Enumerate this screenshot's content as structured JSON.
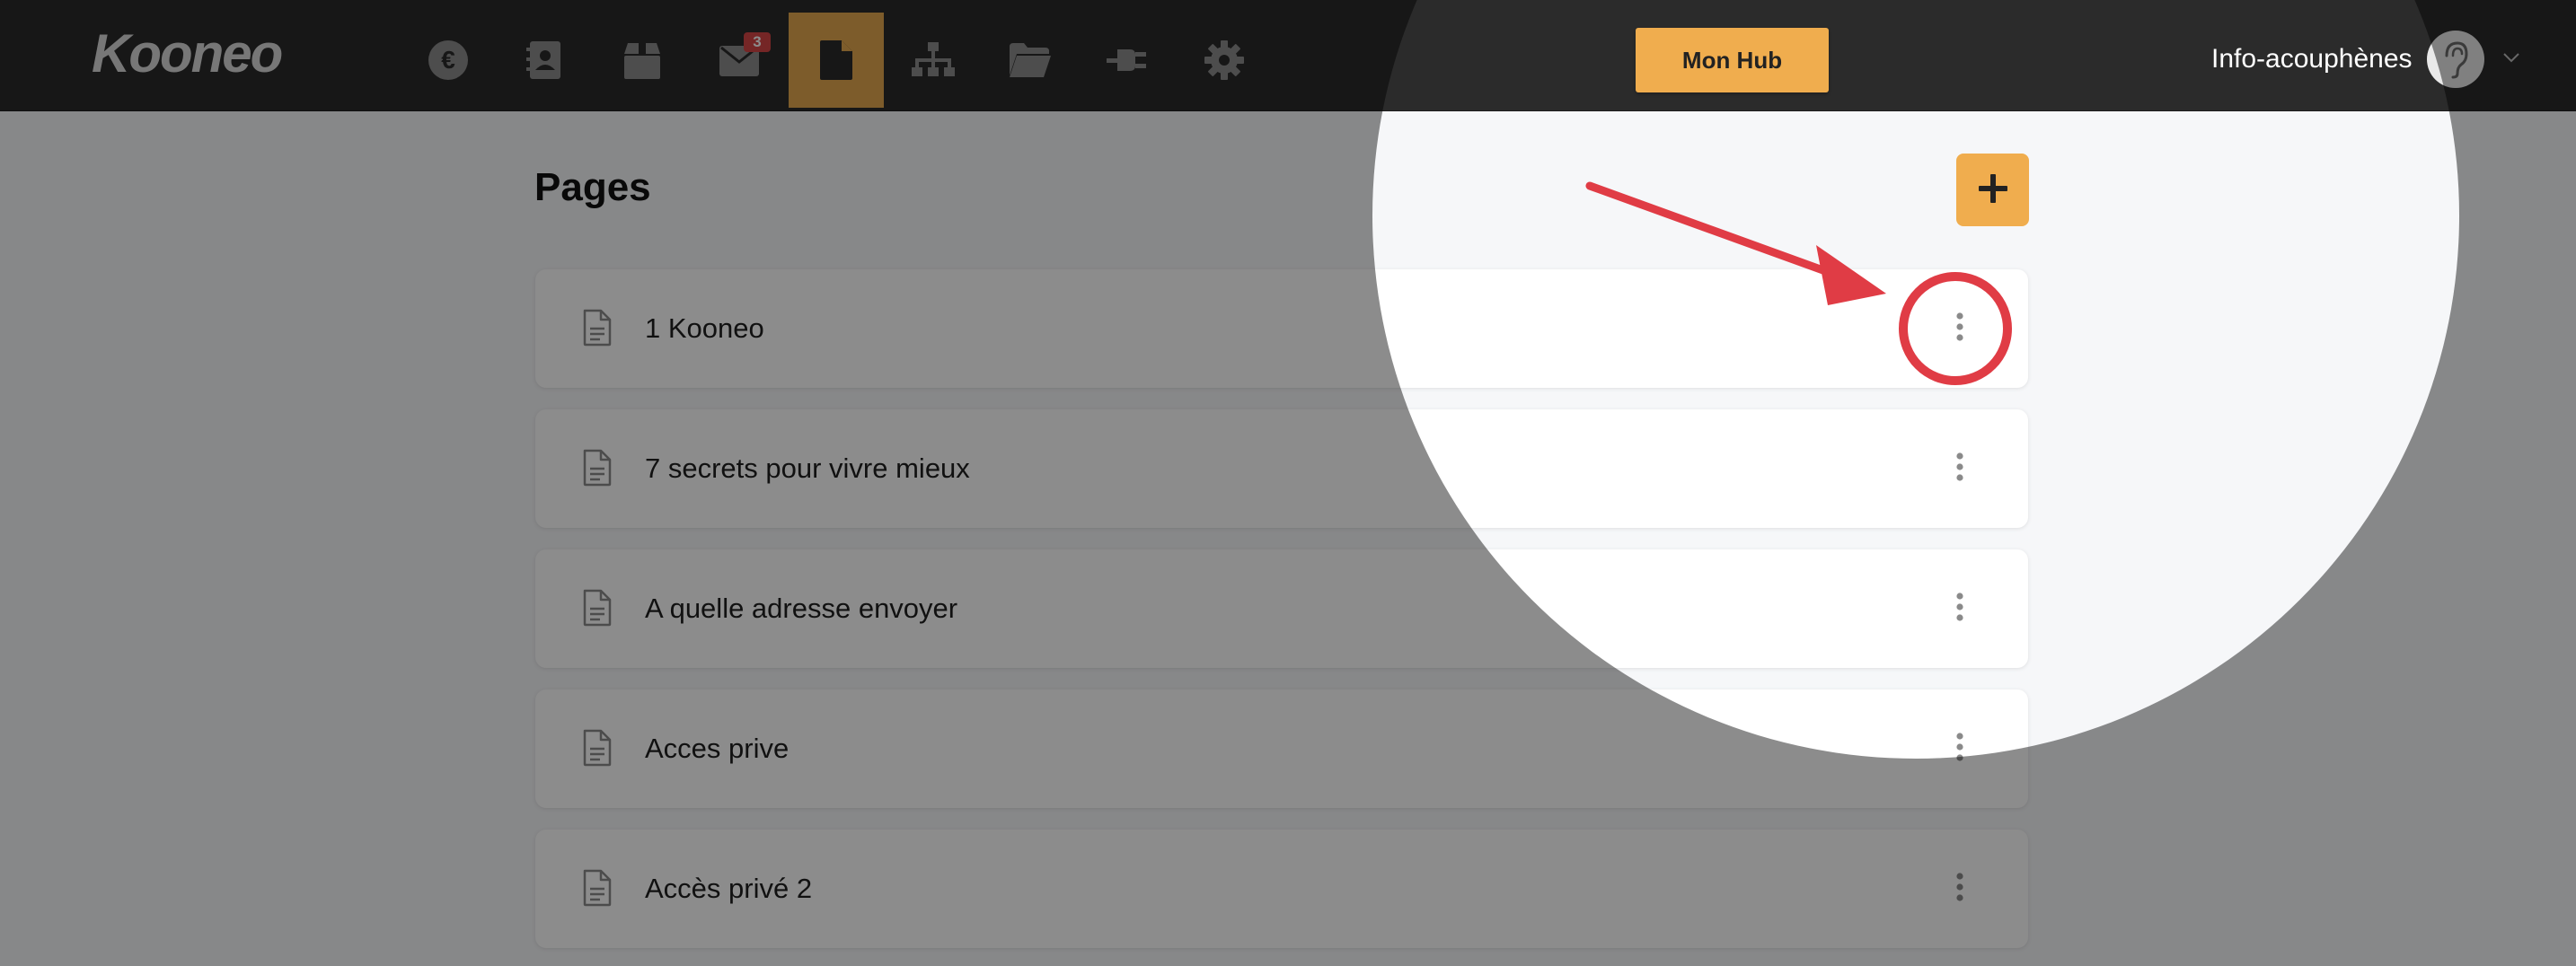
{
  "header": {
    "logo_text": "Kooneo",
    "nav_items": [
      {
        "icon": "euro-icon",
        "active": false
      },
      {
        "icon": "contacts-icon",
        "active": false
      },
      {
        "icon": "box-icon",
        "active": false
      },
      {
        "icon": "mail-icon",
        "active": false,
        "badge": "3"
      },
      {
        "icon": "page-icon",
        "active": true
      },
      {
        "icon": "sitemap-icon",
        "active": false
      },
      {
        "icon": "folder-icon",
        "active": false
      },
      {
        "icon": "plug-icon",
        "active": false
      },
      {
        "icon": "gear-icon",
        "active": false
      }
    ],
    "hub_button_label": "Mon Hub",
    "account_name": "Info-acouphènes",
    "account_avatar_icon": "ear-icon",
    "account_menu_icon": "chevron-down-icon"
  },
  "main": {
    "title": "Pages",
    "add_button_icon": "plus-icon",
    "pages": [
      {
        "label": "1 Kooneo"
      },
      {
        "label": "7 secrets pour vivre mieux"
      },
      {
        "label": "A quelle adresse envoyer"
      },
      {
        "label": "Acces prive"
      },
      {
        "label": "Accès privé 2"
      }
    ],
    "row_icon": "document-icon",
    "row_menu_icon": "vertical-dots-icon"
  },
  "annotation": {
    "arrow_color": "#e03c45",
    "circle_color": "#e03c45",
    "dim_color": "#000000"
  },
  "colors": {
    "accent": "#f0ad4e",
    "topbar": "#2b2b2b",
    "badge": "#d64545"
  }
}
